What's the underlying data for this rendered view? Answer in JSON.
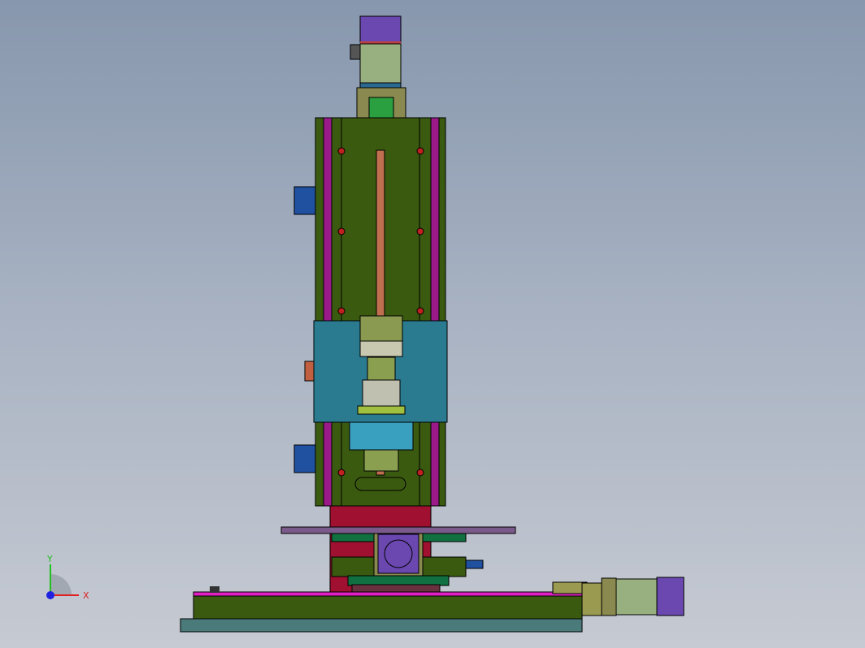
{
  "viewport": {
    "background_top": "#8797ad",
    "background_bottom": "#c6cad2"
  },
  "triad": {
    "x_label": "X",
    "y_label": "Y",
    "x_color": "#e02020",
    "y_color": "#20c020",
    "z_color": "#2020e0"
  },
  "colors": {
    "frame_green": "#3a5a10",
    "rail_magenta": "#9a1a8a",
    "carriage_blue": "#2a7a90",
    "motor_purple": "#6a48b0",
    "motor_body": "#98b080",
    "base_teal": "#4a7a7a",
    "column_red": "#a01030"
  }
}
